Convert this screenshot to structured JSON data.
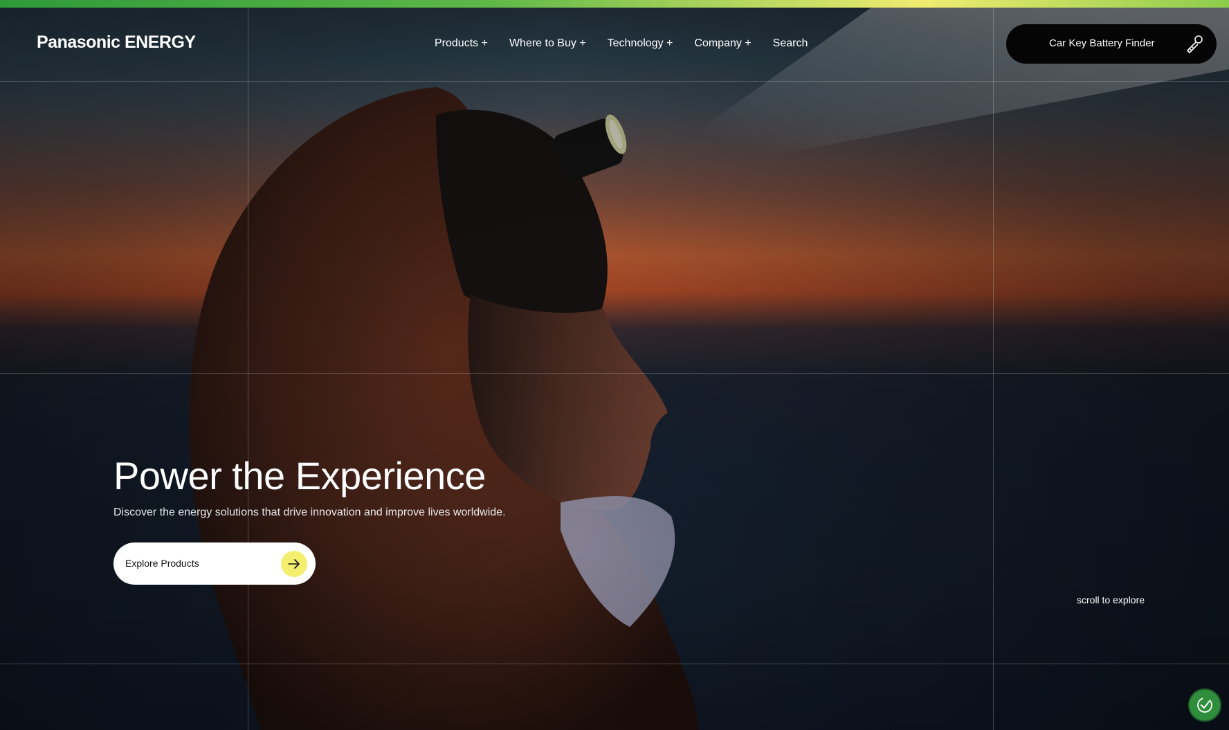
{
  "header": {
    "logo_text": "Panasonic ENERGY",
    "nav": [
      {
        "label": "Products +"
      },
      {
        "label": "Where to Buy +"
      },
      {
        "label": "Technology +"
      },
      {
        "label": "Company +"
      },
      {
        "label": "Search"
      }
    ],
    "finder_button": {
      "label": "Car Key Battery Finder",
      "icon": "car-key-icon"
    }
  },
  "hero": {
    "headline": "Power the Experience",
    "subline": "Discover the energy solutions that drive innovation and improve lives worldwide.",
    "cta": {
      "label": "Explore Products",
      "icon": "arrow-right-icon",
      "icon_bg_color": "#f3ee6e"
    },
    "scroll_hint": "scroll to explore"
  },
  "badge": {
    "icon": "accessibility-check-icon",
    "color": "#2f8e3c"
  },
  "colors": {
    "accent_bar_start": "#2e9a3a",
    "accent_bar_mid": "#f1ec70",
    "finder_button_bg": "#050505"
  }
}
